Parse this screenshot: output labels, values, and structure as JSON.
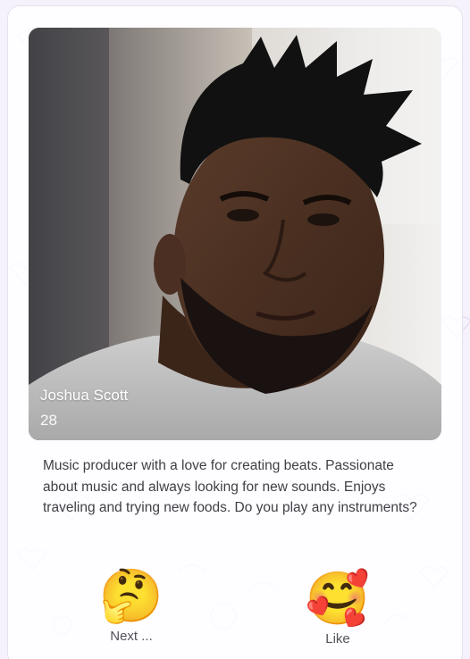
{
  "profile": {
    "name": "Joshua Scott",
    "age": "28",
    "bio": "Music producer with a love for creating beats. Passionate about music and always looking for new sounds. Enjoys traveling and trying new foods. Do you play any instruments?"
  },
  "actions": {
    "next": {
      "emoji": "🤔",
      "label": "Next ..."
    },
    "like": {
      "emoji": "🥰",
      "label": "Like"
    }
  },
  "colors": {
    "background": "#f6f2fb",
    "text": "#3f3f46",
    "label": "#52525b",
    "overlay_text": "#ffffff"
  },
  "icons": [
    "thinking-face-icon",
    "smiling-face-with-hearts-icon"
  ]
}
